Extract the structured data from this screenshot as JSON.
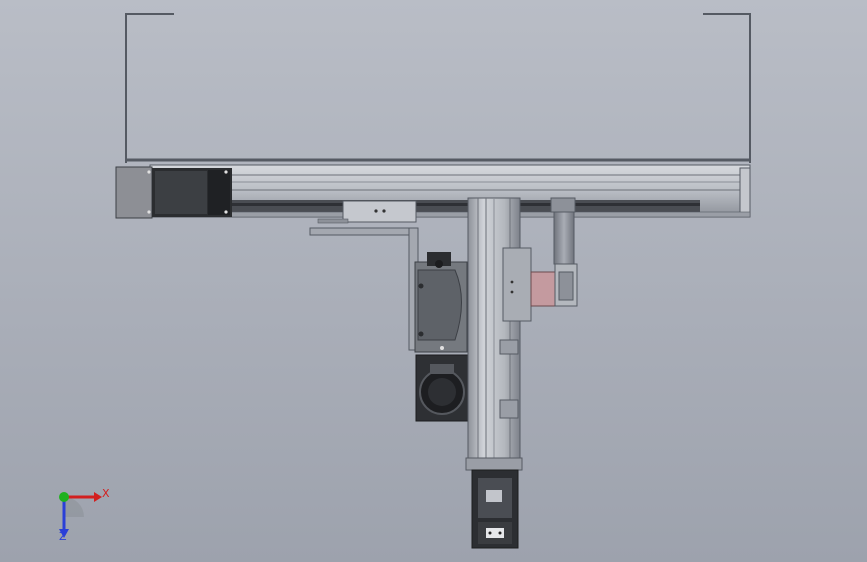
{
  "viewport": {
    "background_top": "#b9bdc6",
    "background_bottom": "#9da2ad"
  },
  "model": {
    "components": [
      "bracket-frame",
      "horizontal-linear-axis",
      "horizontal-axis-motor",
      "horizontal-carriage",
      "mounting-bracket",
      "servo-motor",
      "gearbox",
      "vertical-linear-axis",
      "vertical-carriage",
      "pneumatic-cylinder",
      "gripper-end-effector"
    ],
    "colors": {
      "frame_stroke": "#555a63",
      "rail_light": "#c8ccd3",
      "rail_dark": "#4a4d53",
      "motor_dark": "#2b2d30",
      "carriage_pink": "#c49a9f"
    }
  },
  "triad": {
    "x_label": "X",
    "z_label": "Z",
    "x_color": "#d21f1f",
    "y_color": "#1fb11f",
    "z_color": "#2a3fd8"
  }
}
